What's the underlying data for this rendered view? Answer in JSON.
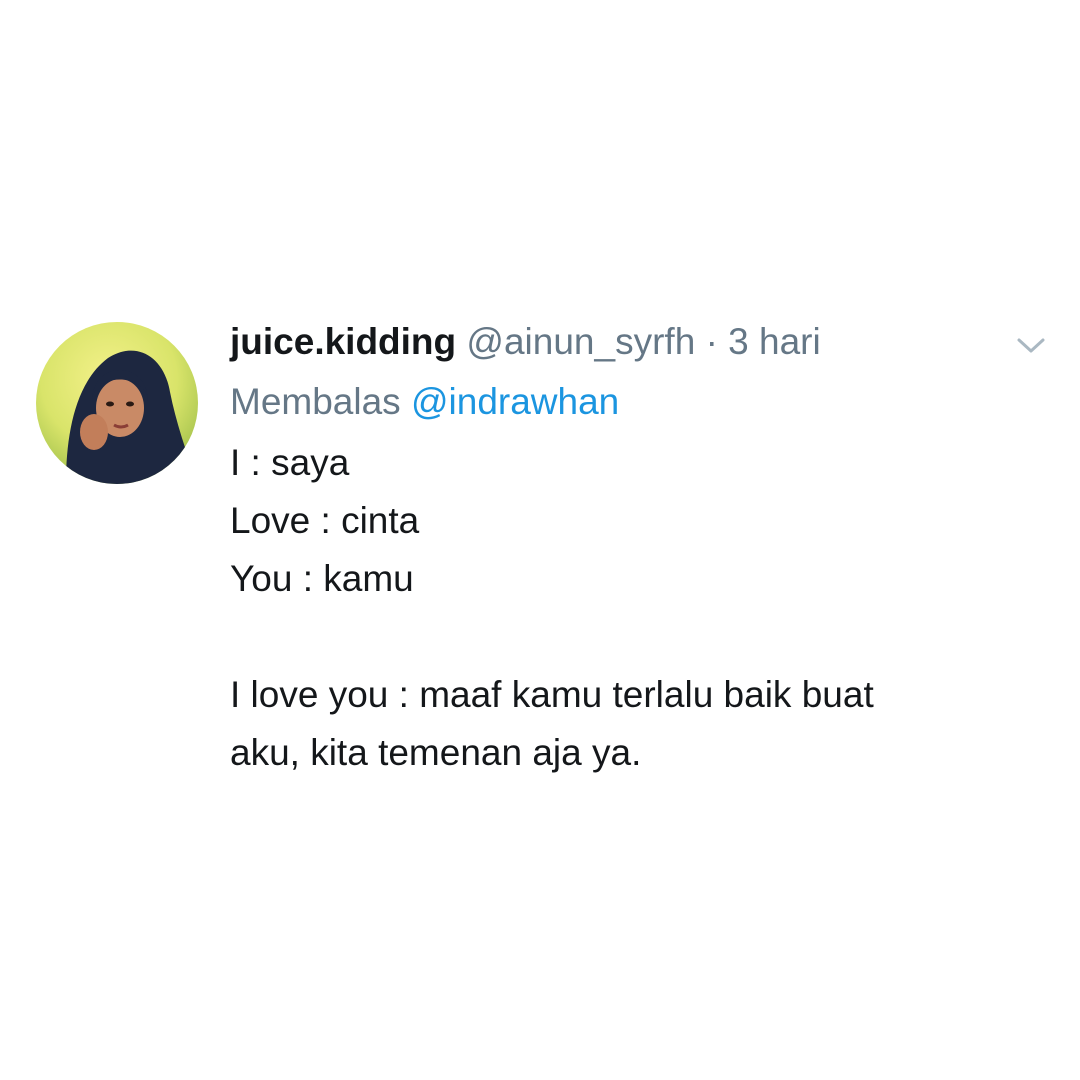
{
  "tweet": {
    "display_name": "juice.kidding",
    "handle": "@ainun_syrfh",
    "separator": "·",
    "time": "3 hari",
    "reply_prefix": "Membalas",
    "reply_mention": "@indrawhan",
    "lines": [
      "I : saya",
      "Love : cinta",
      "You : kamu",
      "",
      "I love you : maaf kamu terlalu baik buat",
      "aku, kita temenan aja ya."
    ],
    "menu_icon": "chevron-down-icon",
    "avatar_icon": "profile-photo"
  },
  "colors": {
    "text": "#14171a",
    "secondary": "#657786",
    "link": "#1b95e0",
    "chevron": "#aab8c2"
  }
}
